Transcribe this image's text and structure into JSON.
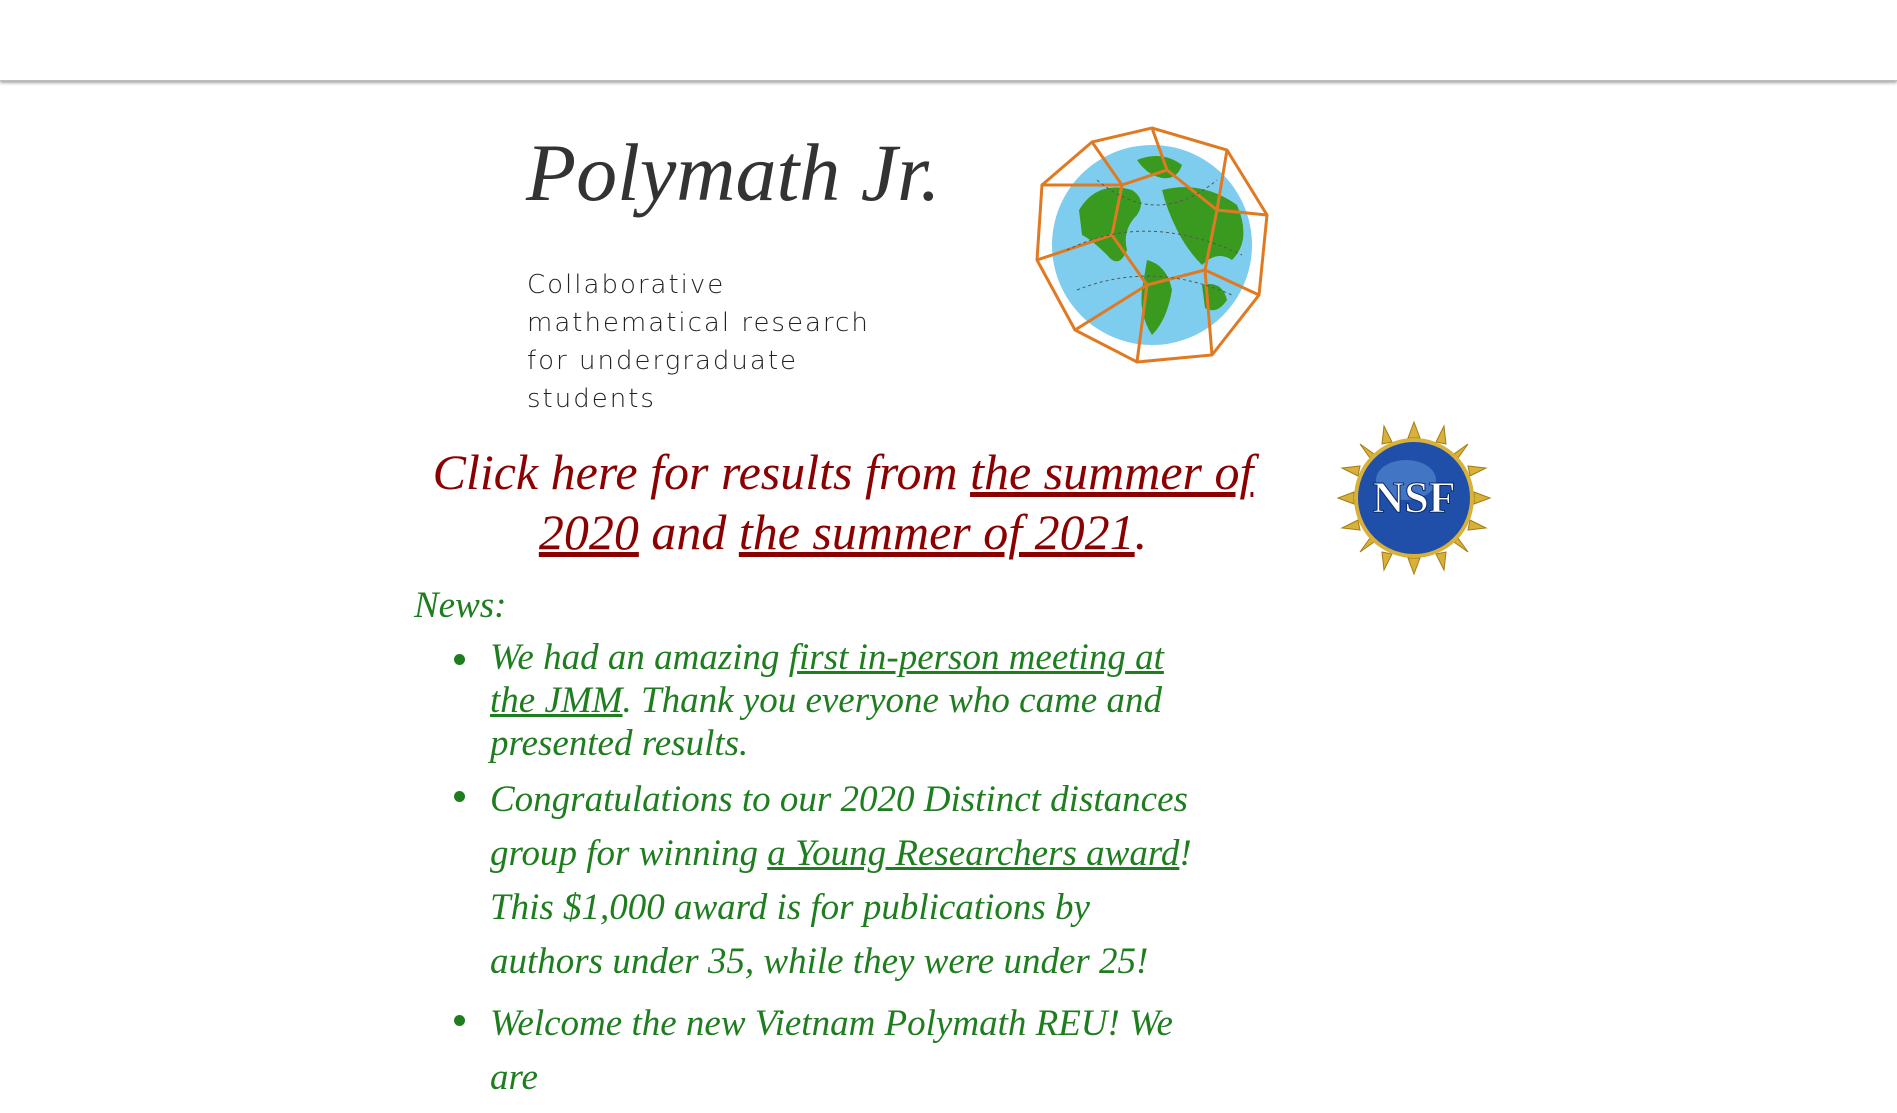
{
  "header": {
    "title": "Polymath Jr.",
    "tagline": "Collaborative mathematical research for undergraduate students"
  },
  "logos": {
    "globe": "polyhedron-globe-logo",
    "nsf": "NSF"
  },
  "results_banner": {
    "prefix": "Click here for results from ",
    "link_2020": "the summer of 2020",
    "middle": " and ",
    "link_2021": "the summer of 2021",
    "suffix": "."
  },
  "news": {
    "label": "News:",
    "items": [
      {
        "before": "We had an amazing ",
        "link": "first in-person meeting at the JMM",
        "after": ". Thank you everyone who came and presented results."
      },
      {
        "before": "Congratulations to our 2020 Distinct distances group for winning ",
        "link": "a Young Researchers award",
        "after": "! This $1,000 award is for publications by authors under 35, while they were under 25!"
      },
      {
        "before": "Welcome the new Vietnam Polymath REU! We are"
      }
    ]
  },
  "colors": {
    "banner_red": "#8b0000",
    "news_green": "#1e7d1e",
    "title_gray": "#333333"
  }
}
